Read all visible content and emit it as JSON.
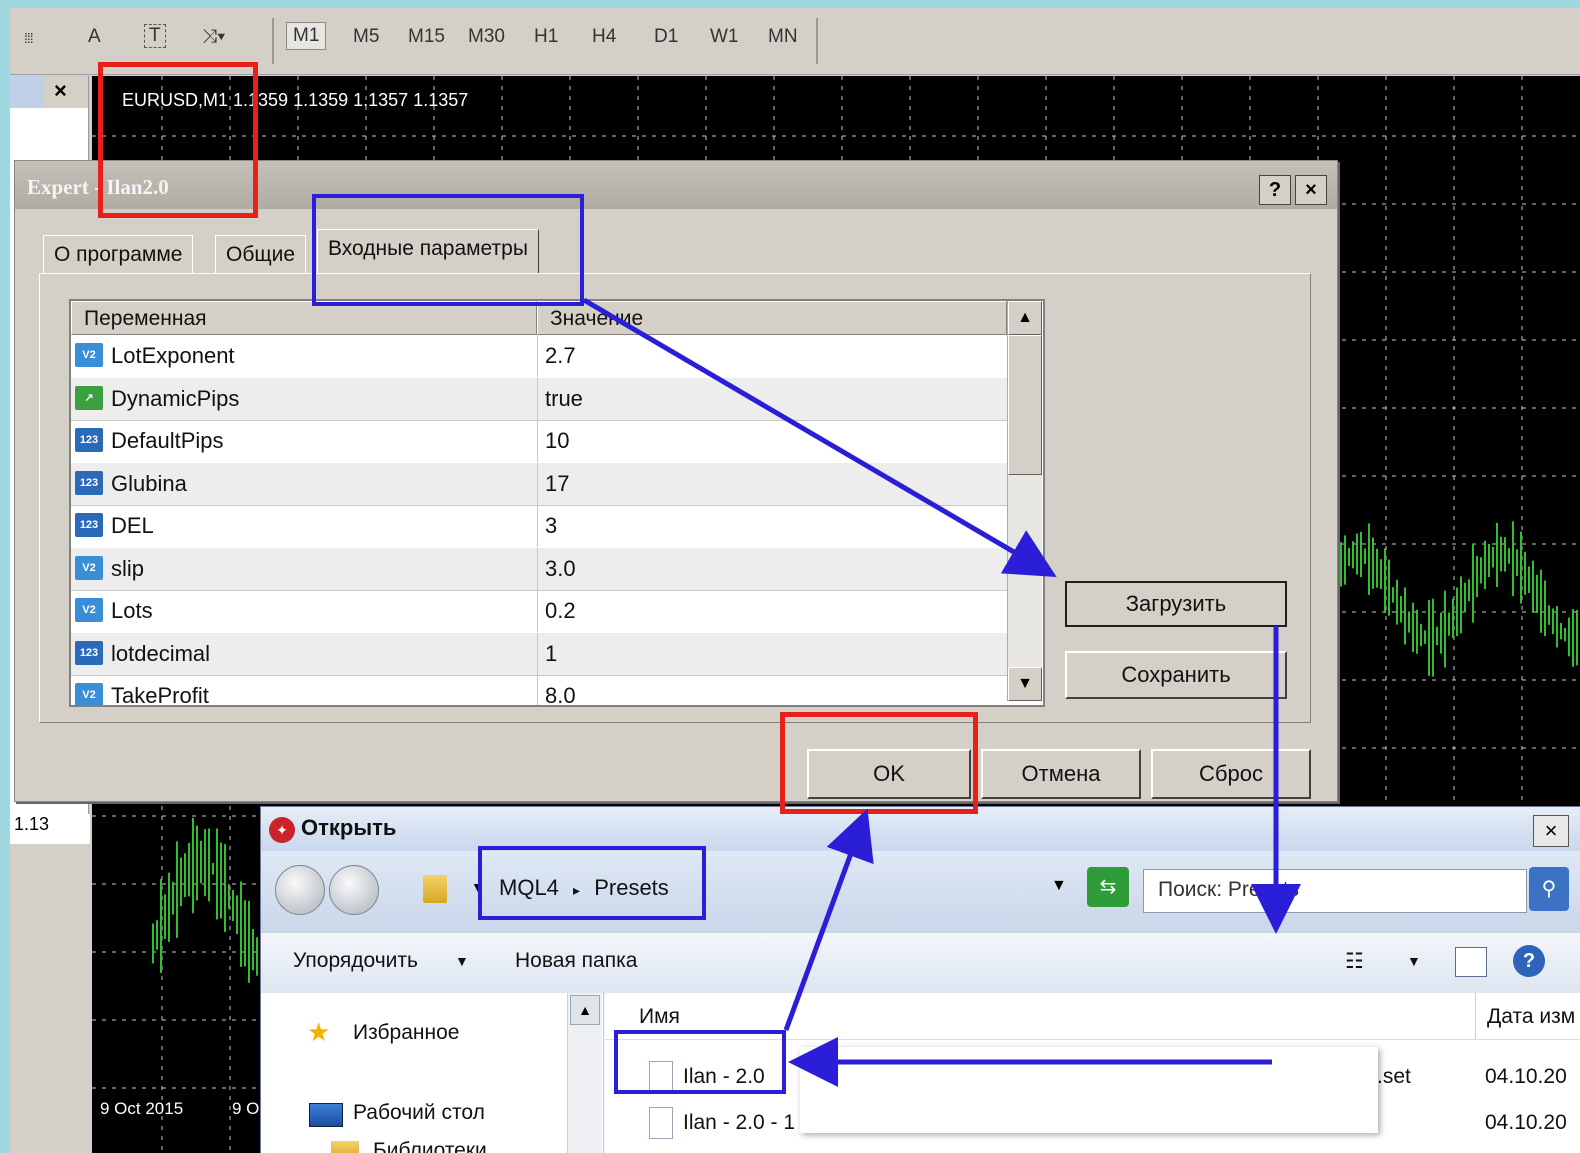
{
  "toolbar": {
    "periods": [
      "M1",
      "M5",
      "M15",
      "M30",
      "H1",
      "H4",
      "D1",
      "W1",
      "MN"
    ]
  },
  "chart": {
    "label": "EURUSD,M1  1.1359 1.1359 1.1357 1.1357",
    "price_label": "1.13",
    "date1": "9 Oct 2015",
    "date2": "9 O",
    "colors": {
      "background": "#000000",
      "candles": "#2fbf2f",
      "grid": "#c8c8c8"
    }
  },
  "nav": {
    "close_glyph": "×"
  },
  "expert_dialog": {
    "title": "Expert - Ilan2.0",
    "help": "?",
    "close": "×",
    "tabs": [
      "О программе",
      "Общие",
      "Входные параметры"
    ],
    "grid": {
      "col_variable": "Переменная",
      "col_value": "Значение",
      "rows": [
        {
          "icon": "V2",
          "name": "LotExponent",
          "value": "2.7"
        },
        {
          "icon": "bool",
          "name": "DynamicPips",
          "value": "true"
        },
        {
          "icon": "123",
          "name": "DefaultPips",
          "value": "10"
        },
        {
          "icon": "123",
          "name": "Glubina",
          "value": "17"
        },
        {
          "icon": "123",
          "name": "DEL",
          "value": "3"
        },
        {
          "icon": "V2",
          "name": "slip",
          "value": "3.0"
        },
        {
          "icon": "V2",
          "name": "Lots",
          "value": "0.2"
        },
        {
          "icon": "123",
          "name": "lotdecimal",
          "value": "1"
        },
        {
          "icon": "V2",
          "name": "TakeProfit",
          "value": "8.0"
        }
      ]
    },
    "btn_load": "Загрузить",
    "btn_save": "Сохранить",
    "btn_ok": "OK",
    "btn_cancel": "Отмена",
    "btn_reset": "Сброс"
  },
  "open_dialog": {
    "title": "Открыть",
    "close": "×",
    "breadcrumb": [
      "MQL4",
      "Presets"
    ],
    "search_placeholder": "Поиск: Presets",
    "organize": "Упорядочить",
    "new_folder": "Новая папка",
    "nav_items": [
      "Избранное",
      "Рабочий стол",
      "Библиотеки"
    ],
    "col_name": "Имя",
    "col_date": "Дата изм",
    "files": [
      {
        "name": "Ilan - 2.0",
        "ext": ".set",
        "date": "04.10.20"
      },
      {
        "name": "Ilan - 2.0 - 1",
        "ext": "",
        "date": "04.10.20"
      }
    ]
  },
  "annotation_colors": {
    "red": "#e8201c",
    "blue": "#2a1fd6"
  }
}
